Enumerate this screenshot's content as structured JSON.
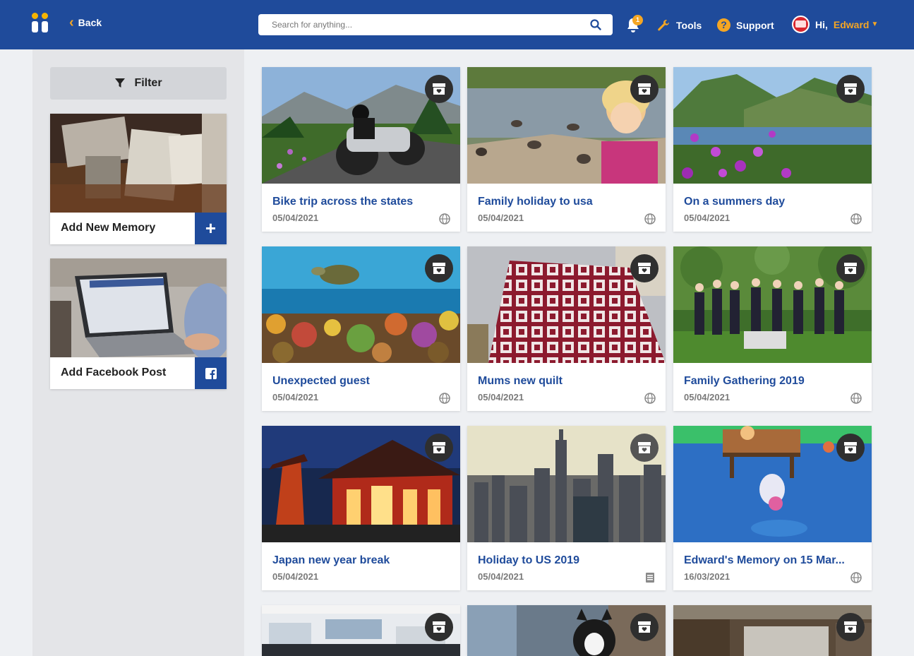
{
  "header": {
    "back_label": "Back",
    "search_placeholder": "Search for anything...",
    "notification_count": "1",
    "tools_label": "Tools",
    "support_label": "Support",
    "greeting": "Hi,",
    "user_name": "Edward",
    "brand_color": "#1f4b9b",
    "accent_color": "#f5a623"
  },
  "sidebar": {
    "filter_label": "Filter",
    "add_memory_label": "Add New Memory",
    "add_facebook_label": "Add Facebook Post"
  },
  "memories": [
    {
      "title": "Bike trip across the states",
      "date": "05/04/2021",
      "visibility": "globe-icon"
    },
    {
      "title": "Family holiday to usa",
      "date": "05/04/2021",
      "visibility": "globe-icon"
    },
    {
      "title": "On a summers day",
      "date": "05/04/2021",
      "visibility": "globe-icon"
    },
    {
      "title": "Unexpected guest",
      "date": "05/04/2021",
      "visibility": "globe-icon"
    },
    {
      "title": "Mums new quilt",
      "date": "05/04/2021",
      "visibility": "globe-icon"
    },
    {
      "title": "Family Gathering 2019",
      "date": "05/04/2021",
      "visibility": "globe-icon"
    },
    {
      "title": "Japan new year break",
      "date": "05/04/2021",
      "visibility": "globe-icon"
    },
    {
      "title": "Holiday to US 2019",
      "date": "05/04/2021",
      "visibility": "book-icon"
    },
    {
      "title": "Edward's Memory on 15 Mar...",
      "date": "16/03/2021",
      "visibility": "globe-icon"
    }
  ]
}
